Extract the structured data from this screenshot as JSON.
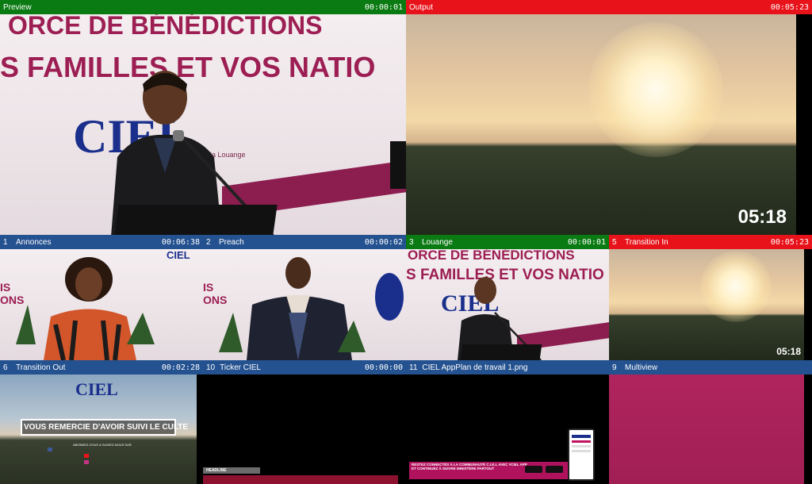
{
  "preview": {
    "label": "Preview",
    "time": "00:00:01"
  },
  "output": {
    "label": "Output",
    "time": "00:05:23",
    "overlay_clock": "05:18"
  },
  "scene_text": {
    "banner_line1": "ORCE DE BÉNÉDICTIONS",
    "banner_line2": "S FAMILLES ET VOS NATIO",
    "logo": "CIEL",
    "logo_tag": "et la Louange",
    "closing_banner": "VOUS REMERCIE D'AVOIR SUIVI LE CULTE",
    "closing_sub": "ABONNEZ-VOUS & SUIVEZ-NOUS SUR",
    "ticker_heading": "HEADLINE",
    "app_strip_1": "RESTEZ CONNECTÉS À LA COMMUNAUTÉ C.I.E.L AVEC #CIEL APP",
    "app_strip_2": "ET CONTINUEZ À SUIVRE MINISTÈRE PARTOUT"
  },
  "sources": [
    {
      "num": "1",
      "label": "Annonces",
      "time": "00:06:38",
      "color": "blue"
    },
    {
      "num": "2",
      "label": "Preach",
      "time": "00:00:02",
      "color": "blue"
    },
    {
      "num": "3",
      "label": "Louange",
      "time": "00:00:01",
      "color": "green"
    },
    {
      "num": "5",
      "label": "Transition In",
      "time": "00:05:23",
      "color": "red",
      "overlay_clock": "05:18"
    },
    {
      "num": "6",
      "label": "Transition Out",
      "time": "00:02:28",
      "color": "blue"
    },
    {
      "num": "10",
      "label": "Ticker CIEL",
      "time": "00:00:00",
      "color": "blue"
    },
    {
      "num": "11",
      "label": "CIEL AppPlan de travail 1.png",
      "time": "",
      "color": "blue"
    },
    {
      "num": "9",
      "label": "Multiview",
      "time": "",
      "color": "blue"
    }
  ],
  "colors": {
    "program_red": "#e8131a",
    "preview_green": "#0a7a12",
    "source_blue": "#24518f"
  }
}
